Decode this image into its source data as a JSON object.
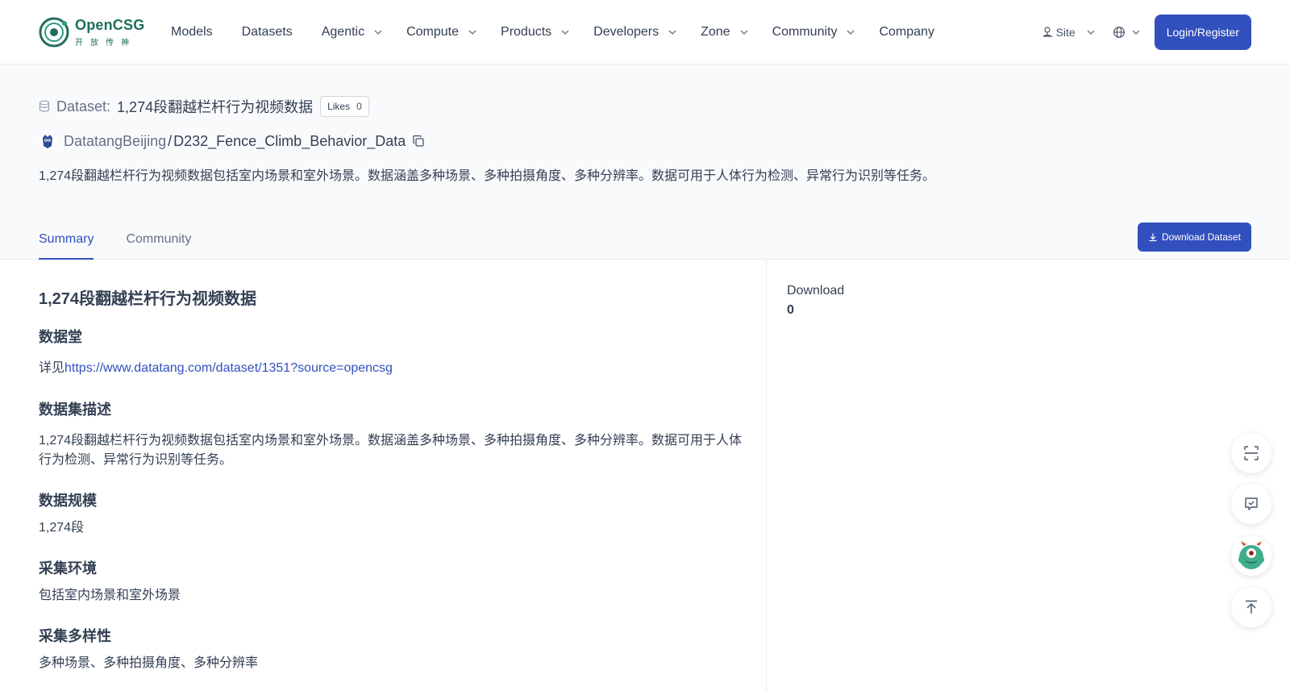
{
  "header": {
    "logo_name": "OpenCSG",
    "logo_sub": "开放传神",
    "nav": [
      {
        "label": "Models",
        "has_dropdown": false
      },
      {
        "label": "Datasets",
        "has_dropdown": false
      },
      {
        "label": "Agentic",
        "has_dropdown": true
      },
      {
        "label": "Compute",
        "has_dropdown": true
      },
      {
        "label": "Products",
        "has_dropdown": true
      },
      {
        "label": "Developers",
        "has_dropdown": true
      },
      {
        "label": "Zone",
        "has_dropdown": true
      },
      {
        "label": "Community",
        "has_dropdown": true
      },
      {
        "label": "Company",
        "has_dropdown": false
      }
    ],
    "site_label": "Site",
    "login_label": "Login/Register"
  },
  "dataset": {
    "label": "Dataset:",
    "title": "1,274段翻越栏杆行为视频数据",
    "likes_label": "Likes",
    "likes_count": "0",
    "owner": "DatatangBeijing",
    "separator": "/",
    "repo": "D232_Fence_Climb_Behavior_Data",
    "description": "1,274段翻越栏杆行为视频数据包括室内场景和室外场景。数据涵盖多种场景、多种拍摄角度、多种分辨率。数据可用于人体行为检测、异常行为识别等任务。"
  },
  "tabs": [
    {
      "label": "Summary",
      "active": true
    },
    {
      "label": "Community",
      "active": false
    }
  ],
  "download_button": "Download Dataset",
  "summary": {
    "h1": "1,274段翻越栏杆行为视频数据",
    "s1_title": "数据堂",
    "s1_prefix": "详见",
    "s1_link": "https://www.datatang.com/dataset/1351?source=opencsg",
    "s2_title": "数据集描述",
    "s2_text": "1,274段翻越栏杆行为视频数据包括室内场景和室外场景。数据涵盖多种场景、多种拍摄角度、多种分辨率。数据可用于人体行为检测、异常行为识别等任务。",
    "s3_title": "数据规模",
    "s3_text": "1,274段",
    "s4_title": "采集环境",
    "s4_text": "包括室内场景和室外场景",
    "s5_title": "采集多样性",
    "s5_text": "多种场景、多种拍摄角度、多种分辨率"
  },
  "sidebar": {
    "download_label": "Download",
    "download_count": "0"
  },
  "colors": {
    "accent": "#3250bd",
    "brand": "#1f6f5c",
    "hero_bg": "#f9fafb"
  },
  "floating_icons": [
    "scan-icon",
    "check-message-icon",
    "monster-mascot-icon",
    "back-to-top-icon"
  ]
}
